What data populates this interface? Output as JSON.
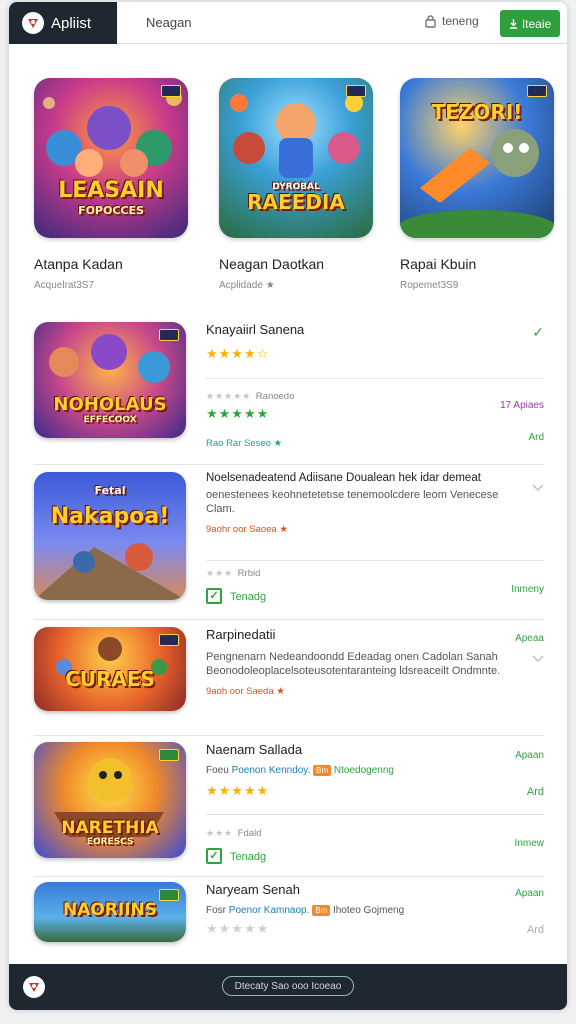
{
  "header": {
    "brand": "Apliist",
    "nav": "Neagan",
    "signin": "teneng",
    "cta": "Iteaie"
  },
  "featured": [
    {
      "art": "LEASAIN",
      "art_sub": "FOPOCCES",
      "title": "Atanpa Kadan",
      "sub": "Acquelrat3S7"
    },
    {
      "art": "RAEEDIA",
      "art_sub": "DYROBAL",
      "title": "Neagan Daotkan",
      "sub": "Acplidade ★"
    },
    {
      "art": "TEZORI!",
      "art_sub": "",
      "title": "Rapai Kbuin",
      "sub": "Ropemet3S9"
    }
  ],
  "list": [
    {
      "art": "NOHOLAUS",
      "art_sub": "EFFECOOX",
      "title": "Knayaiirl Sanena",
      "link": "Rao Rar Seseo ★",
      "side_note_a": "✓",
      "side_note_b": "17 Apiaes",
      "side_note_c": "Ard",
      "rating_label": "Ranoedo",
      "stars_gold": "★★★★☆",
      "stars_grey": "★★★★★",
      "stars_green": "★★★★★"
    },
    {
      "art": "Nakapoa!",
      "art_sub": "Fetal",
      "title": "Noelsenadeatend Adiisane Doualean hek idar demeat",
      "desc": "oenestenees keohnetetetıse tenemoolcdere leom Venecese Clam.",
      "link": "9aohr oor Saoea ★",
      "rating_label": "Rrbid",
      "status": "Tenadg",
      "side_note": "Inmeny"
    },
    {
      "art": "CURAES",
      "title": "Rarpinedatii",
      "desc": "Pengnenarn Nedeandoondd Edeadag onen Cadolan Sanah Beonodoleoplacelsoteusotentaranteing ldsreaceilt Ondmnte.",
      "link": "9aoh oor Saeda ★",
      "side_note": "Apeaa"
    },
    {
      "art": "NARETHIA",
      "art_sub": "EORESCS",
      "title": "Naenam Sallada",
      "meta_a": "Foeu",
      "meta_b": "Poenon Kenndoy.",
      "meta_tag": "Bm",
      "meta_c": "Ntoedogenng",
      "stars_gold": "★★★★★",
      "rating_label": "Fdald",
      "status": "Tenadg",
      "side_note_a": "Apaan",
      "side_note_b": "Ard",
      "side_note_c": "Inmew"
    },
    {
      "art": "NAORIINS",
      "title": "Naryeam Senah",
      "meta_a": "Fosr",
      "meta_b": "Poenor Kamnaop.",
      "meta_tag": "Bm",
      "meta_c": "Ihoteo Gojmeng",
      "side_note_a": "Apaan",
      "side_note_b": "Ard"
    }
  ],
  "footer": {
    "pill": "Dtecaty Sao ooo Icoeao"
  }
}
